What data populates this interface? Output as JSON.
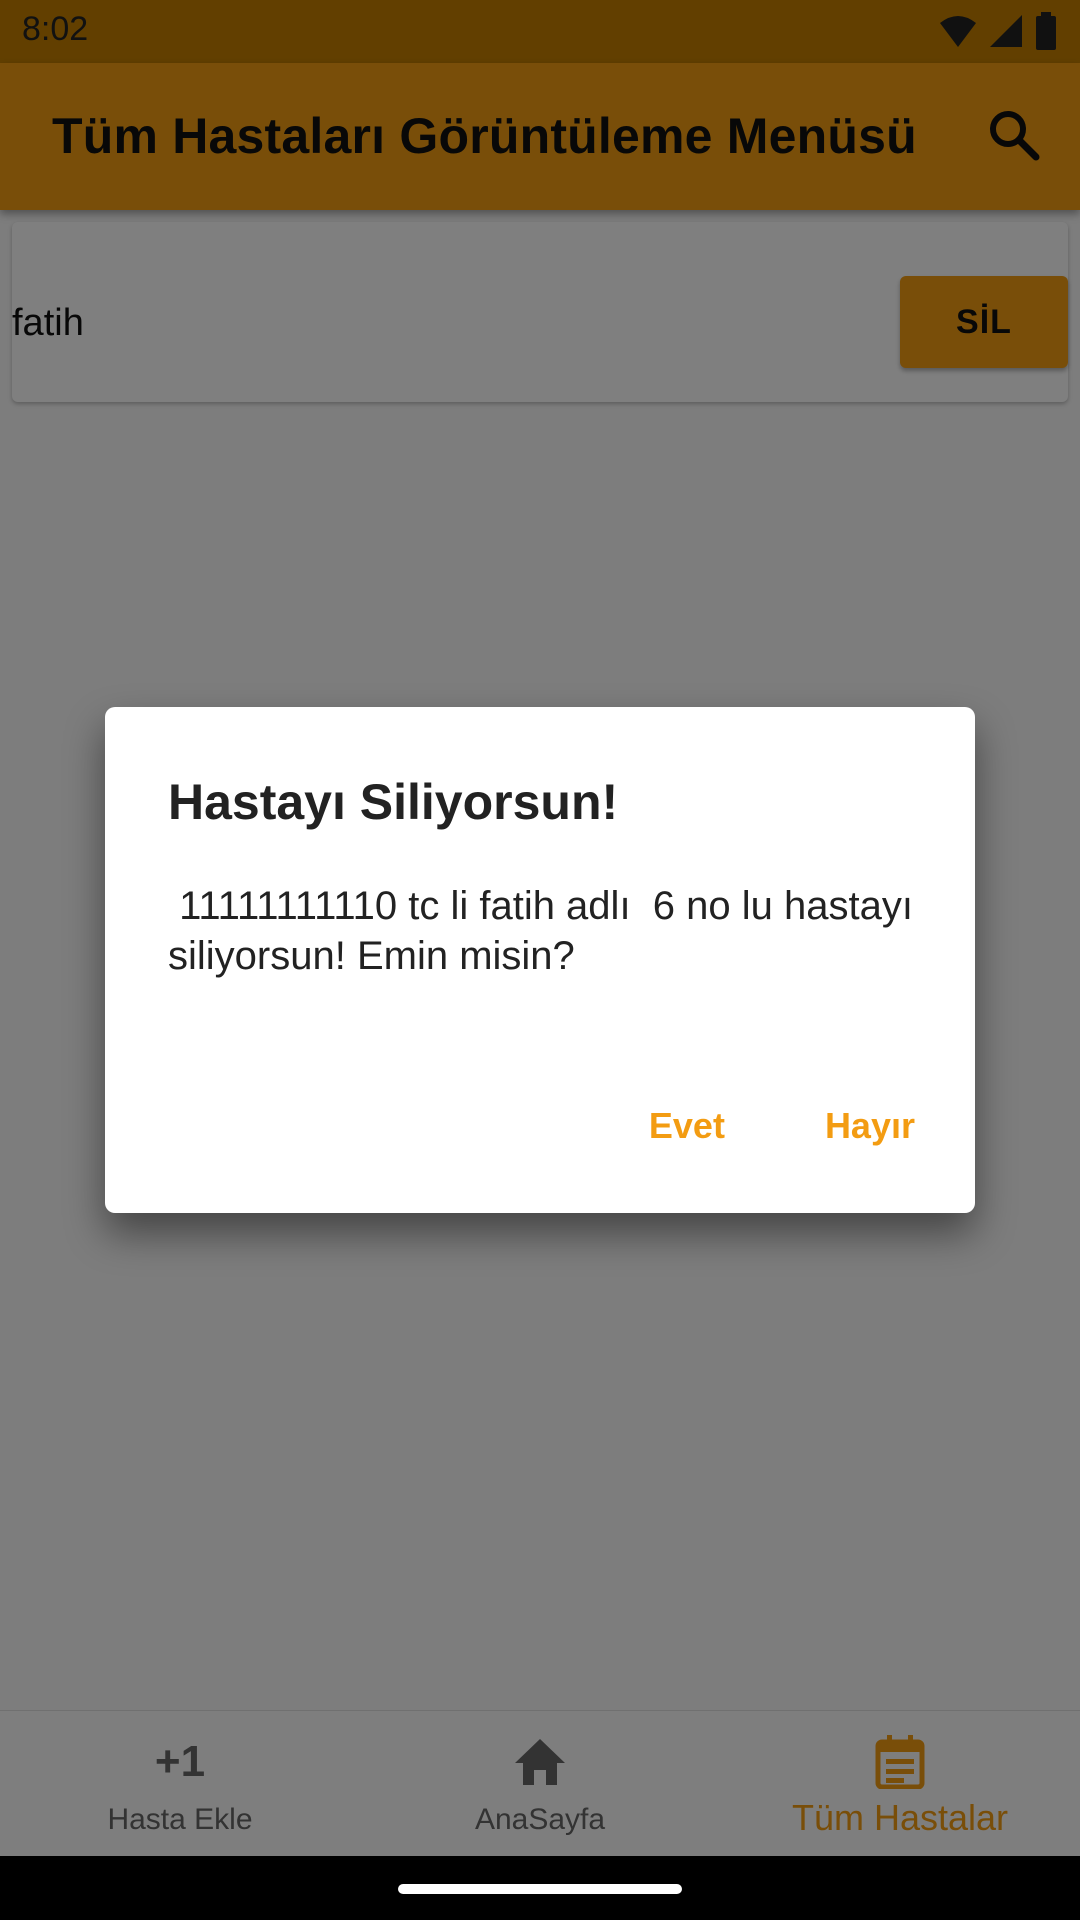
{
  "status_bar": {
    "time": "8:02",
    "icons": [
      "wifi-icon",
      "signal-icon",
      "battery-icon"
    ]
  },
  "app_bar": {
    "title": "Tüm Hastaları Görüntüleme Menüsü",
    "search_icon": "search-icon"
  },
  "patients": [
    {
      "name": "fatih",
      "delete_label": "SİL"
    }
  ],
  "dialog": {
    "title": "Hastayı Siliyorsun!",
    "message": " 11111111110 tc li fatih adlı  6 no lu hastayı siliyorsun! Emin misin?",
    "confirm_label": "Evet",
    "cancel_label": "Hayır"
  },
  "bottom_nav": {
    "items": [
      {
        "label": "Hasta Ekle",
        "icon": "plus-one-icon",
        "icon_text": "+1"
      },
      {
        "label": "AnaSayfa",
        "icon": "home-icon"
      },
      {
        "label": "Tüm Hastalar",
        "icon": "calendar-list-icon",
        "active": true
      }
    ]
  },
  "colors": {
    "accent": "#f39c12",
    "status_bar": "#c47f00",
    "scrim": "rgba(0,0,0,0.5)"
  }
}
